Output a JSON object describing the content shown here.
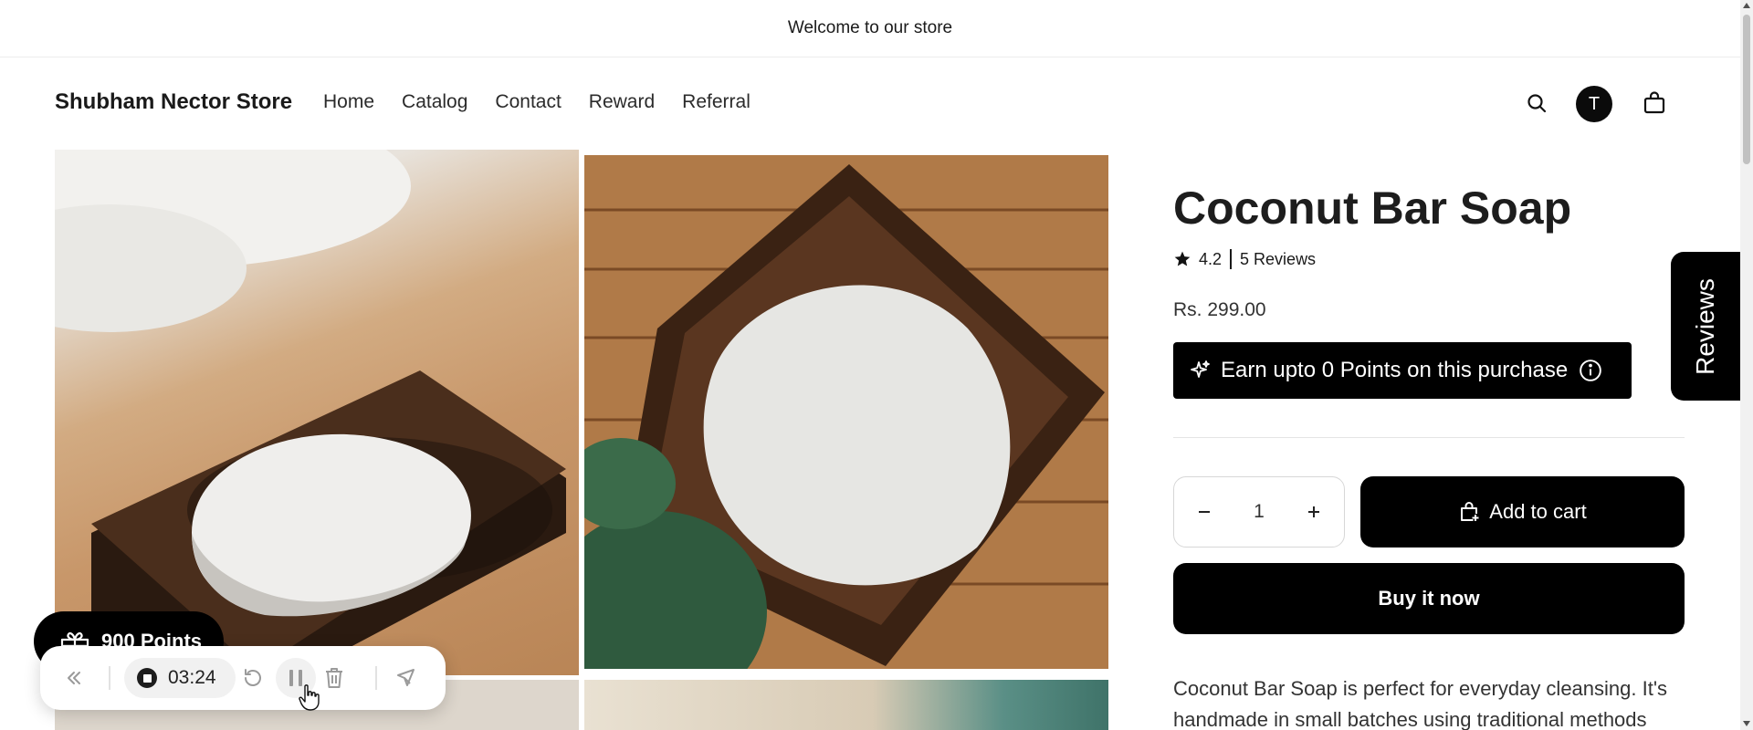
{
  "announcement": {
    "text": "Welcome to our store"
  },
  "header": {
    "logo": "Shubham Nector Store",
    "nav": [
      "Home",
      "Catalog",
      "Contact",
      "Reward",
      "Referral"
    ],
    "account_initial": "T",
    "icons": [
      "search-icon",
      "account-icon",
      "cart-icon"
    ]
  },
  "product": {
    "title": "Coconut Bar Soap",
    "rating": "4.2",
    "reviews": "5 Reviews",
    "price": "Rs. 299.00",
    "points_banner": "Earn upto 0 Points on this purchase",
    "quantity": "1",
    "add_to_cart": "Add to cart",
    "buy_now": "Buy it now",
    "description": "Coconut Bar Soap is perfect for everyday cleansing. It's handmade in small batches using traditional methods"
  },
  "reviews_tab": {
    "label": "Reviews"
  },
  "points_widget": {
    "label": "900 Points"
  },
  "recorder": {
    "time": "03:24"
  },
  "colors": {
    "primary": "#000000",
    "text": "#121212",
    "muted": "#333333",
    "border": "#d7d7d7"
  }
}
